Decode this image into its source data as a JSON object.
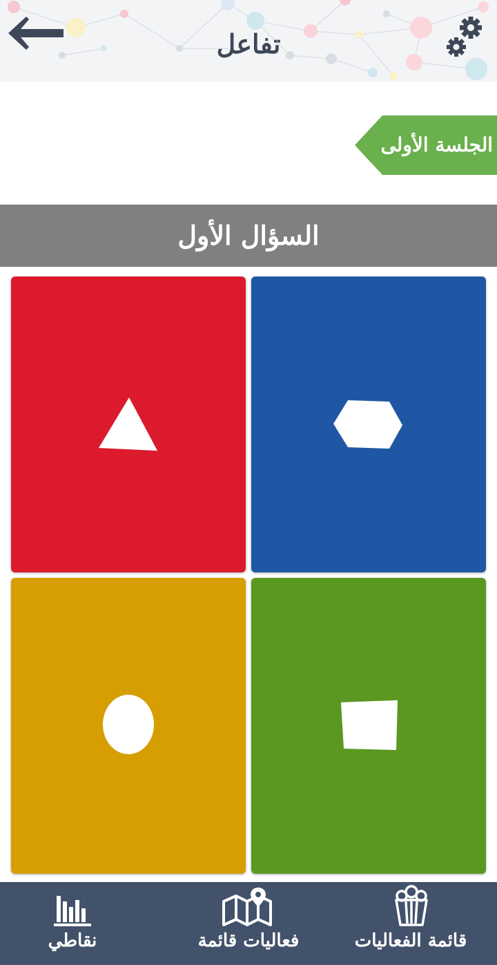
{
  "header": {
    "title": "تفاعل",
    "back_icon": "arrow-left-icon",
    "settings_icon": "gears-icon"
  },
  "session": {
    "label": "الجلسة الأولى",
    "color": "#6ab04c"
  },
  "question": {
    "title": "السؤال الأول"
  },
  "answers": [
    {
      "shape": "triangle-icon",
      "color": "#dc1a2e"
    },
    {
      "shape": "hexagon-icon",
      "color": "#1f57a4"
    },
    {
      "shape": "circle-icon",
      "color": "#d69e00"
    },
    {
      "shape": "square-icon",
      "color": "#5a9821"
    }
  ],
  "bottom_nav": {
    "background": "#43526b",
    "items": [
      {
        "label": "نقاطي",
        "icon": "bar-chart-icon"
      },
      {
        "label": "فعاليات قائمة",
        "icon": "map-pin-icon"
      },
      {
        "label": "قائمة الفعاليات",
        "icon": "popcorn-icon"
      }
    ]
  }
}
